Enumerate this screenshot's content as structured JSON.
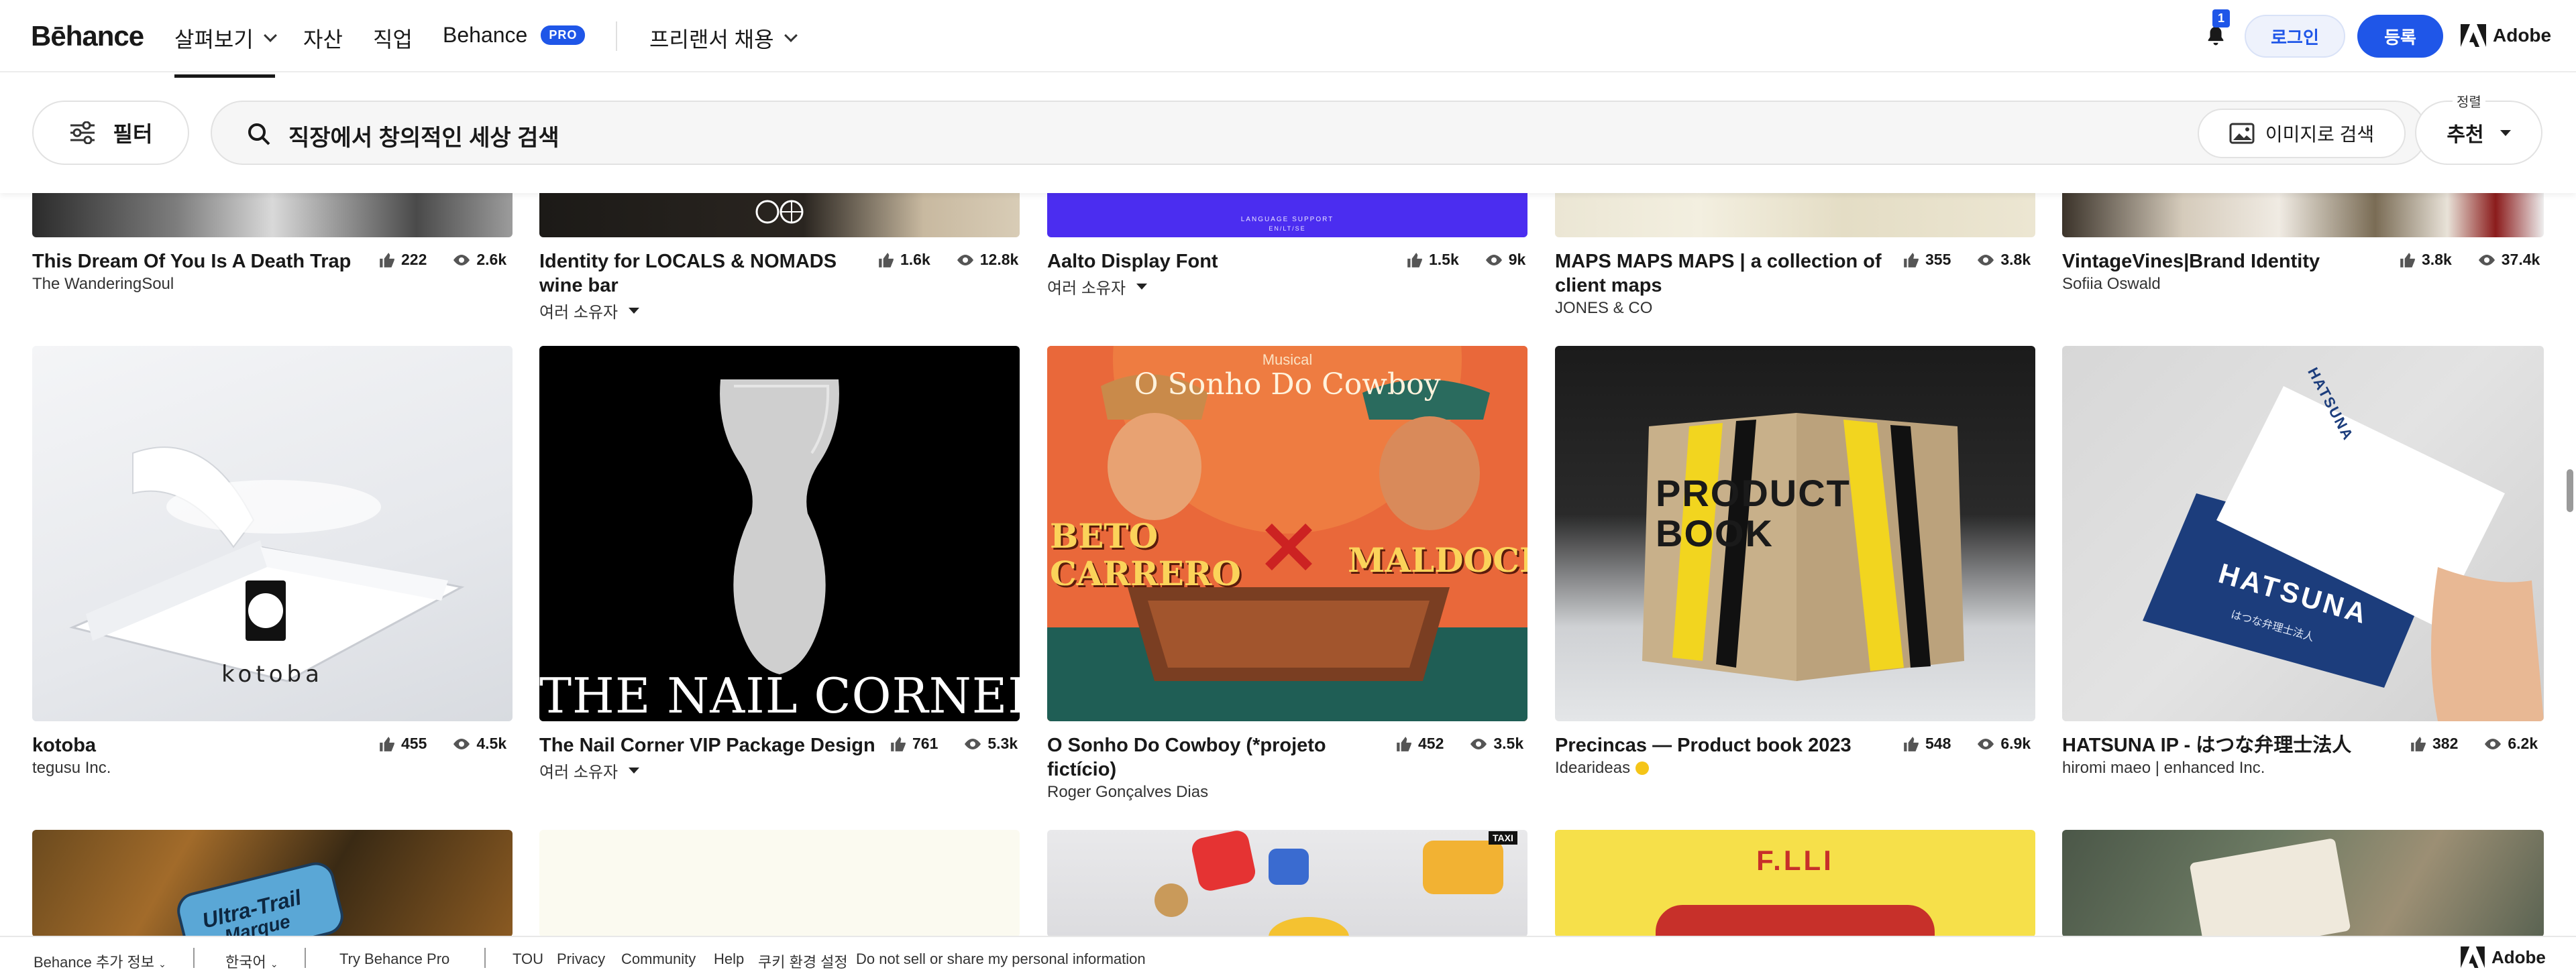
{
  "nav": {
    "logo": "Bēhance",
    "explore": "살펴보기",
    "assets": "자산",
    "jobs": "직업",
    "behance": "Behance",
    "pro": "PRO",
    "freelance": "프리랜서 채용",
    "notification_count": "1",
    "login": "로그인",
    "signup": "등록",
    "adobe": "Adobe"
  },
  "search": {
    "filter": "필터",
    "placeholder": "직장에서 창의적인 세상 검색",
    "image_search": "이미지로 검색",
    "sort_label": "정렬",
    "sort_value": "추천"
  },
  "row1": [
    {
      "title": "This Dream Of You Is A Death Trap",
      "owner": "The WanderingSoul",
      "likes": "222",
      "views": "2.6k"
    },
    {
      "title": "Identity for LOCALS & NOMADS wine bar",
      "owner": "여러 소유자",
      "likes": "1.6k",
      "views": "12.8k"
    },
    {
      "title": "Aalto Display Font",
      "owner": "여러 소유자",
      "likes": "1.5k",
      "views": "9k"
    },
    {
      "title": "MAPS MAPS MAPS | a collection of client maps",
      "owner": "JONES & CO",
      "likes": "355",
      "views": "3.8k"
    },
    {
      "title": "VintageVines|Brand Identity",
      "owner": "Sofiia Oswald",
      "likes": "3.8k",
      "views": "37.4k"
    }
  ],
  "row2": [
    {
      "title": "kotoba",
      "owner": "tegusu Inc.",
      "likes": "455",
      "views": "4.5k"
    },
    {
      "title": "The Nail Corner VIP Package Design",
      "owner": "여러 소유자",
      "likes": "761",
      "views": "5.3k"
    },
    {
      "title": "O Sonho Do Cowboy (*projeto fictício)",
      "owner": "Roger Gonçalves Dias",
      "likes": "452",
      "views": "3.5k"
    },
    {
      "title": "Precincas — Product book 2023",
      "owner": "Idearideas",
      "likes": "548",
      "views": "6.9k"
    },
    {
      "title": "HATSUNA IP - はつな弁理士法人",
      "owner": "hiromi maeo | enhanced Inc.",
      "likes": "382",
      "views": "6.2k"
    }
  ],
  "art": {
    "aalto_caption": "LANGUAGE SUPPORT",
    "aalto_caption2": "EN/LT/SE",
    "kotoba": "kotoba",
    "nailcorner": "THE NAIL CORNER",
    "cowboy_musical": "Musical",
    "cowboy_title": "O Sonho Do Cowboy",
    "cowboy_left": "BETO CARRERO",
    "cowboy_right": "MALDOCK",
    "product_book": "PRODUCT BOOK",
    "hatsuna": "HATSUNA",
    "hatsuna_sub": "はつな弁理士法人",
    "hatsuna_card": "HATSUNA",
    "ultra_trail": "Ultra-Trail",
    "ultra_trail2": "Marque",
    "flli": "F.LLI",
    "taxi": "TAXI"
  },
  "footer": {
    "more": "Behance 추가 정보",
    "lang": "한국어",
    "try_pro": "Try Behance Pro",
    "tou": "TOU",
    "privacy": "Privacy",
    "community": "Community",
    "help": "Help",
    "cookie": "쿠키 환경 설정",
    "dnsmpi": "Do not sell or share my personal information",
    "adobe": "Adobe"
  },
  "colors": {
    "accent": "#1f56e8",
    "aalto_bg": "#4b2df0",
    "cowboy_bg": "#e8683a"
  }
}
